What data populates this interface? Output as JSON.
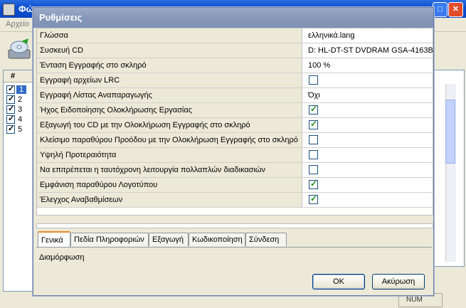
{
  "background_app": {
    "title": "Φώ",
    "menu_label": "Αρχείο",
    "list_header": "#",
    "rows": [
      "1",
      "2",
      "3",
      "4",
      "5"
    ],
    "status": "NUM"
  },
  "dialog": {
    "title": "Ρυθμίσεις",
    "settings": [
      {
        "label": "Γλώσσα",
        "type": "text",
        "value": "ελληνικά.lang"
      },
      {
        "label": "Συσκευή CD",
        "type": "text",
        "value": "D: HL-DT-ST DVDRAM GSA-4163B"
      },
      {
        "label": "Ένταση Εγγραφής στο σκληρό",
        "type": "text",
        "value": "100 %"
      },
      {
        "label": "Εγγραφή αρχείων LRC",
        "type": "checkbox",
        "checked": false
      },
      {
        "label": "Εγγραφή Λίστας Αναπαραγωγής",
        "type": "text",
        "value": "Όχι"
      },
      {
        "label": "Ήχος Ειδοποίησης Ολοκλήρωσης Εργασίας",
        "type": "checkbox",
        "checked": true
      },
      {
        "label": "Εξαγωγή του CD με την Ολοκλήρωση Εγγραφής στο σκληρό",
        "type": "checkbox",
        "checked": true
      },
      {
        "label": "Κλείσιμο παραθύρου Προόδου με την Ολοκλήρωση Εγγραφής στο σκληρό",
        "type": "checkbox",
        "checked": false
      },
      {
        "label": "Υψηλή Προτεραιότητα",
        "type": "checkbox",
        "checked": false
      },
      {
        "label": "Να επιτρέπεται η ταυτόχρονη λειτουργία πολλαπλών διαδικασιών",
        "type": "checkbox",
        "checked": false
      },
      {
        "label": "Εμφάνιση παραθύρου Λογοτύπου",
        "type": "checkbox",
        "checked": true
      },
      {
        "label": "Έλεγχος Αναβαθμίσεων",
        "type": "checkbox",
        "checked": true
      }
    ],
    "tabs": [
      "Γενικά",
      "Πεδία Πληροφοριών",
      "Εξαγωγή",
      "Κωδικοποίηση",
      "Σύνδεση"
    ],
    "active_tab": "Γενικά",
    "description": "Διαμόρφωση",
    "ok_label": "OK",
    "cancel_label": "Ακύρωση"
  }
}
